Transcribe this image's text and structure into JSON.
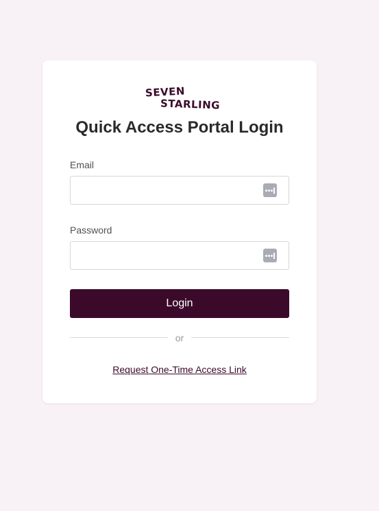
{
  "brand": {
    "logo_line1": "SEVEN",
    "logo_line2": "STARLING",
    "accent_color": "#3b0a2a"
  },
  "title": "Quick Access Portal Login",
  "form": {
    "email": {
      "label": "Email",
      "value": "",
      "icon": "password-manager-icon"
    },
    "password": {
      "label": "Password",
      "value": "",
      "icon": "password-manager-icon"
    },
    "login_label": "Login"
  },
  "divider_text": "or",
  "access_link_text": "Request One-Time Access Link"
}
